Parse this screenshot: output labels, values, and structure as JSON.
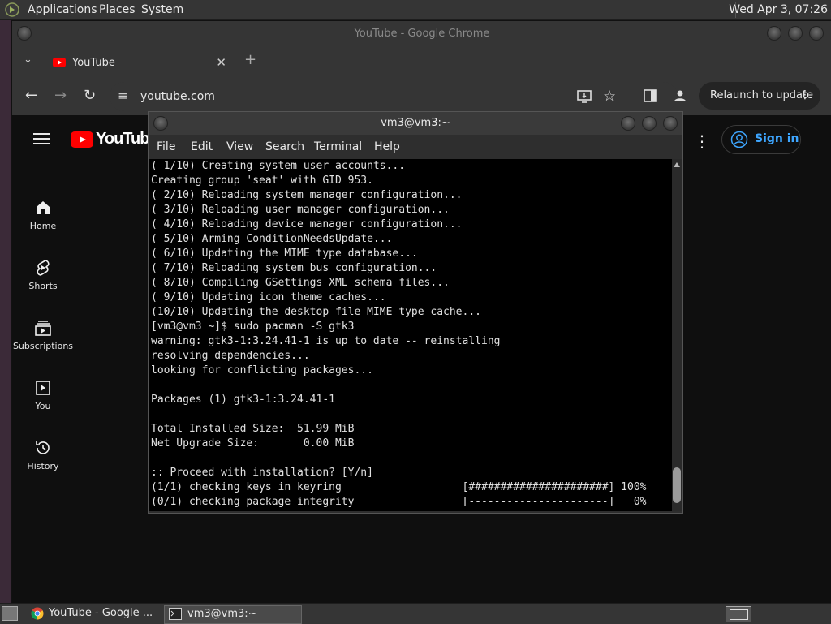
{
  "top_panel": {
    "menus": [
      "Applications",
      "Places",
      "System"
    ],
    "clock": "Wed Apr  3, 07:26"
  },
  "chrome": {
    "window_title": "YouTube - Google Chrome",
    "tab_title": "YouTube",
    "url": "youtube.com",
    "relaunch_label": "Relaunch to update"
  },
  "youtube": {
    "logo_text": "YouTube",
    "sidebar": [
      {
        "label": "Home",
        "icon": "home-icon"
      },
      {
        "label": "Shorts",
        "icon": "shorts-icon"
      },
      {
        "label": "Subscriptions",
        "icon": "subscriptions-icon"
      },
      {
        "label": "You",
        "icon": "you-icon"
      },
      {
        "label": "History",
        "icon": "history-icon"
      }
    ],
    "signin_label": "Sign in"
  },
  "terminal": {
    "title": "vm3@vm3:~",
    "menus": [
      "File",
      "Edit",
      "View",
      "Search",
      "Terminal",
      "Help"
    ],
    "lines": [
      "( 1/10) Creating system user accounts...",
      "Creating group 'seat' with GID 953.",
      "( 2/10) Reloading system manager configuration...",
      "( 3/10) Reloading user manager configuration...",
      "( 4/10) Reloading device manager configuration...",
      "( 5/10) Arming ConditionNeedsUpdate...",
      "( 6/10) Updating the MIME type database...",
      "( 7/10) Reloading system bus configuration...",
      "( 8/10) Compiling GSettings XML schema files...",
      "( 9/10) Updating icon theme caches...",
      "(10/10) Updating the desktop file MIME type cache...",
      "[vm3@vm3 ~]$ sudo pacman -S gtk3",
      "warning: gtk3-1:3.24.41-1 is up to date -- reinstalling",
      "resolving dependencies...",
      "looking for conflicting packages...",
      "",
      "Packages (1) gtk3-1:3.24.41-1",
      "",
      "Total Installed Size:  51.99 MiB",
      "Net Upgrade Size:       0.00 MiB",
      "",
      ":: Proceed with installation? [Y/n]",
      "(1/1) checking keys in keyring                   [######################] 100%",
      "(0/1) checking package integrity                 [----------------------]   0%"
    ]
  },
  "taskbar": {
    "items": [
      {
        "label": "YouTube - Google ...",
        "icon": "chrome-icon",
        "active": false
      },
      {
        "label": "vm3@vm3:~",
        "icon": "terminal-icon",
        "active": true
      }
    ]
  }
}
